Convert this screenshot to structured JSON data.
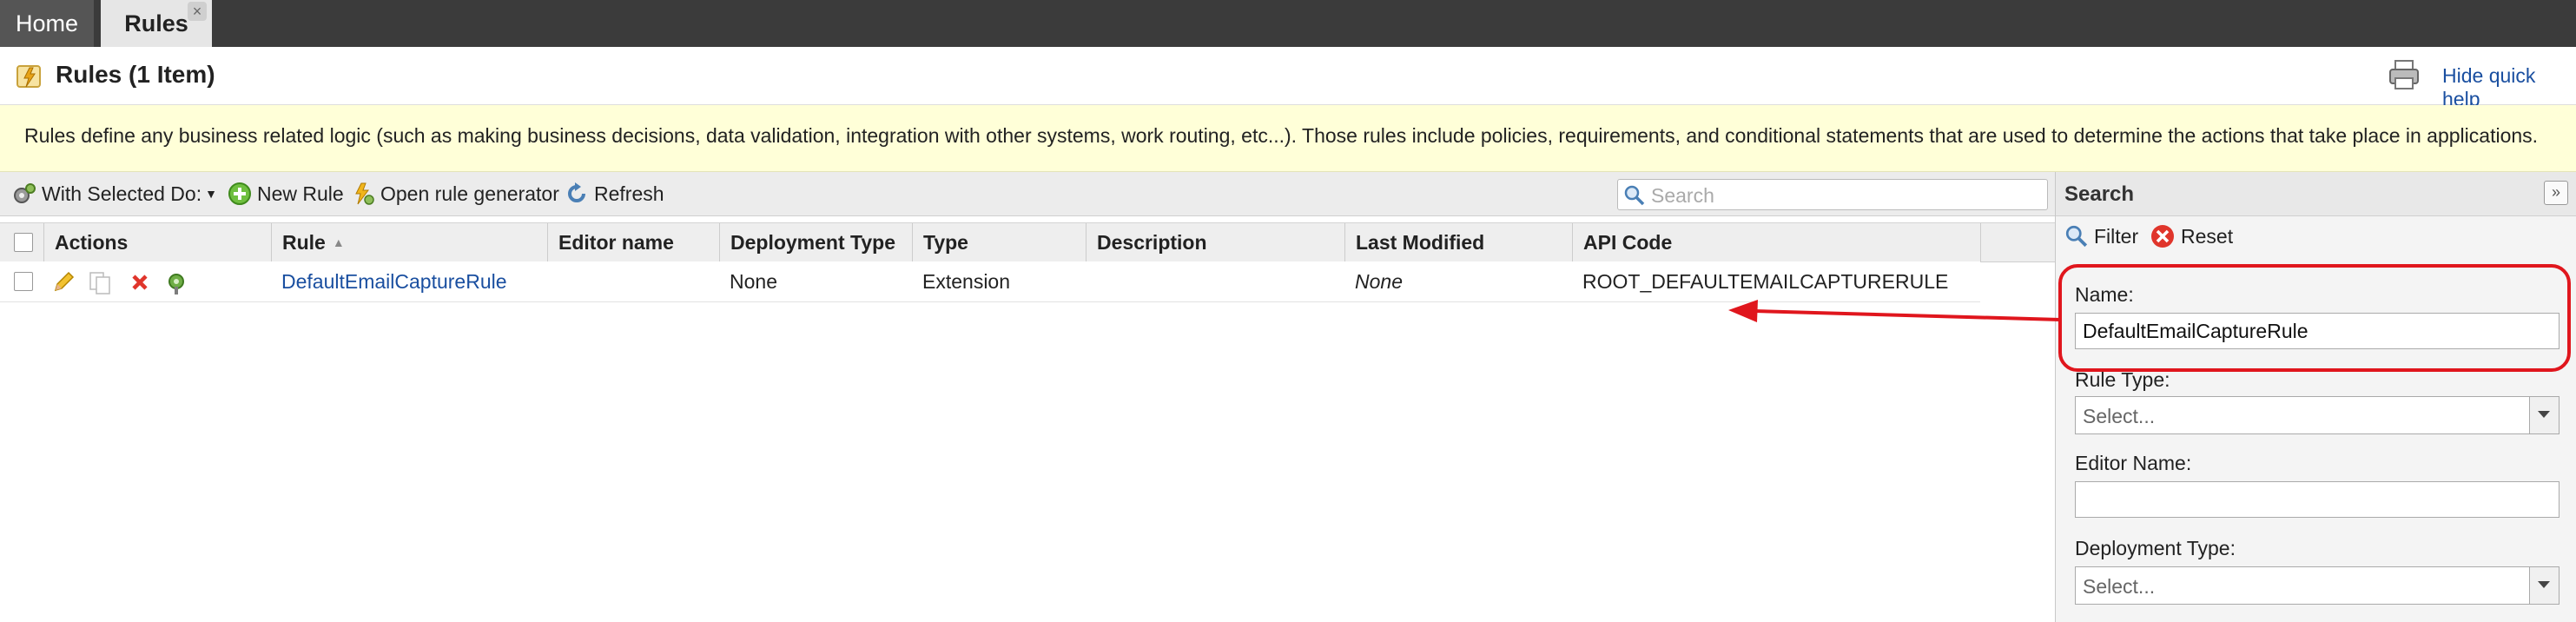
{
  "tabs": [
    {
      "label": "Home",
      "active": false
    },
    {
      "label": "Rules",
      "active": true
    }
  ],
  "tab_close_glyph": "×",
  "header": {
    "title": "Rules (1 Item)",
    "hide_help": "Hide quick help"
  },
  "help_text": "Rules define any business related logic (such as making business decisions, data validation, integration with other systems, work routing, etc...). Those rules include policies, requirements, and conditional statements that are used to determine the actions that take place in applications.",
  "toolbar": {
    "with_selected": "With Selected Do:",
    "new_rule": "New Rule",
    "open_generator": "Open rule generator",
    "refresh": "Refresh",
    "search_placeholder": "Search"
  },
  "table": {
    "columns": [
      "Actions",
      "Rule",
      "Editor name",
      "Deployment Type",
      "Type",
      "Description",
      "Last Modified",
      "API Code"
    ],
    "rows": [
      {
        "rule": "DefaultEmailCaptureRule",
        "editor_name": "",
        "deployment_type": "None",
        "type": "Extension",
        "description": "",
        "last_modified": "None",
        "api_code": "ROOT_DEFAULTEMAILCAPTURERULE"
      }
    ]
  },
  "panel": {
    "title": "Search",
    "collapse_glyph": "»",
    "filter": "Filter",
    "reset": "Reset",
    "name_label": "Name:",
    "name_value": "DefaultEmailCaptureRule",
    "rule_type_label": "Rule Type:",
    "rule_type_value": "Select...",
    "editor_name_label": "Editor Name:",
    "editor_name_value": "",
    "deployment_type_label": "Deployment Type:",
    "deployment_type_value": "Select..."
  },
  "colors": {
    "tabbar": "#3b3b3b",
    "help_bg": "#ffffd8",
    "link": "#1a4fa0",
    "annotation": "#e0161d"
  }
}
